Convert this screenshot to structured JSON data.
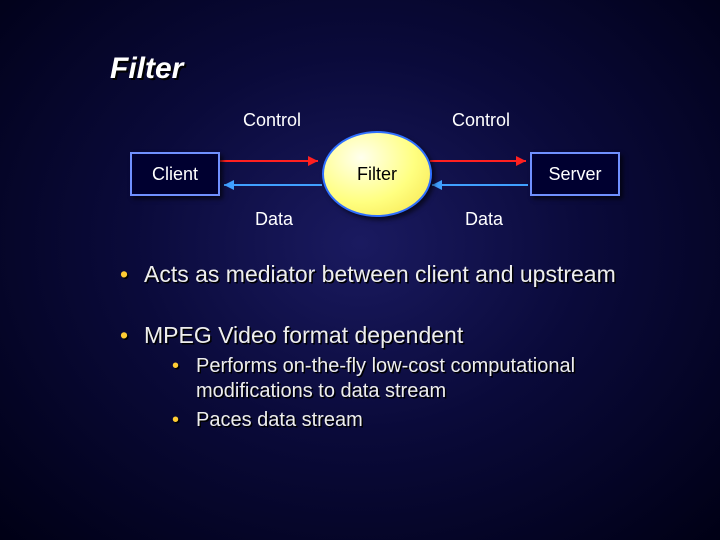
{
  "title": "Filter",
  "diagram": {
    "client": "Client",
    "server": "Server",
    "filter": "Filter",
    "control_left": "Control",
    "control_right": "Control",
    "data_left": "Data",
    "data_right": "Data"
  },
  "bullets": [
    {
      "level": 1,
      "text": "Acts as mediator between client and upstream"
    },
    {
      "level": 1,
      "text": "MPEG Video format dependent",
      "children": [
        {
          "level": 2,
          "text": "Performs on-the-fly low-cost computational modifications to data stream"
        },
        {
          "level": 2,
          "text": "Paces data stream"
        }
      ]
    }
  ]
}
